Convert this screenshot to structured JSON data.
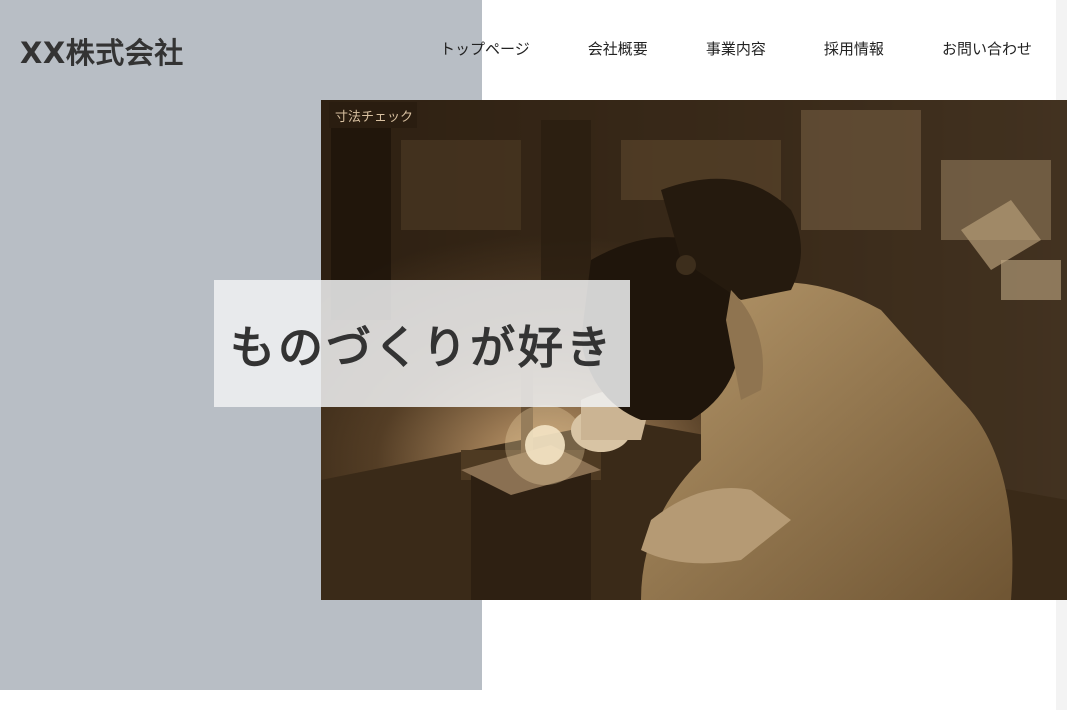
{
  "header": {
    "logo_text": "XX株式会社",
    "nav_items": [
      {
        "label": "トップページ"
      },
      {
        "label": "会社概要"
      },
      {
        "label": "事業内容"
      },
      {
        "label": "採用情報"
      },
      {
        "label": "お問い合わせ"
      }
    ]
  },
  "hero": {
    "tagline": "ものづくりが好き",
    "image_subject": "welder-at-work-photo",
    "sign_text": "寸法チェック"
  },
  "colors": {
    "left_panel": "#b8bec5",
    "text_dark": "#333333",
    "photo_tone": "#3b2b1a",
    "tagline_bg": "#f0f1f2"
  }
}
